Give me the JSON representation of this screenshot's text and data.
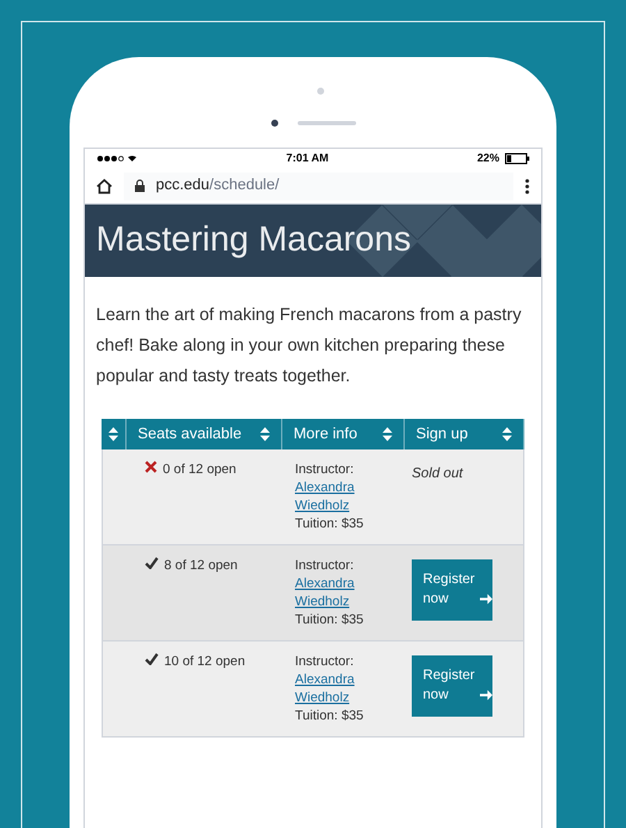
{
  "status_bar": {
    "time": "7:01 AM",
    "battery": "22%"
  },
  "address_bar": {
    "domain": "pcc.edu",
    "path": "/schedule/"
  },
  "banner": {
    "title": "Mastering Macarons"
  },
  "description": "Learn the art of making French macarons from a pastry chef! Bake along in your own kitchen preparing these popular and tasty treats together.",
  "table": {
    "columns": [
      "Seats available",
      "More info",
      "Sign up"
    ],
    "rows": [
      {
        "available": false,
        "seats": "0 of 12 open",
        "instructor_label": "Instructor:",
        "instructor": "Alexandra Wiedholz",
        "tuition": "Tuition: $35",
        "signup": {
          "kind": "text",
          "label": "Sold out"
        }
      },
      {
        "available": true,
        "seats": "8 of 12 open",
        "instructor_label": "Instructor:",
        "instructor": "Alexandra Wiedholz",
        "tuition": "Tuition: $35",
        "signup": {
          "kind": "button",
          "label": "Register now"
        }
      },
      {
        "available": true,
        "seats": "10 of 12 open",
        "instructor_label": "Instructor:",
        "instructor": "Alexandra Wiedholz",
        "tuition": "Tuition: $35",
        "signup": {
          "kind": "button",
          "label": "Register now"
        }
      }
    ]
  }
}
